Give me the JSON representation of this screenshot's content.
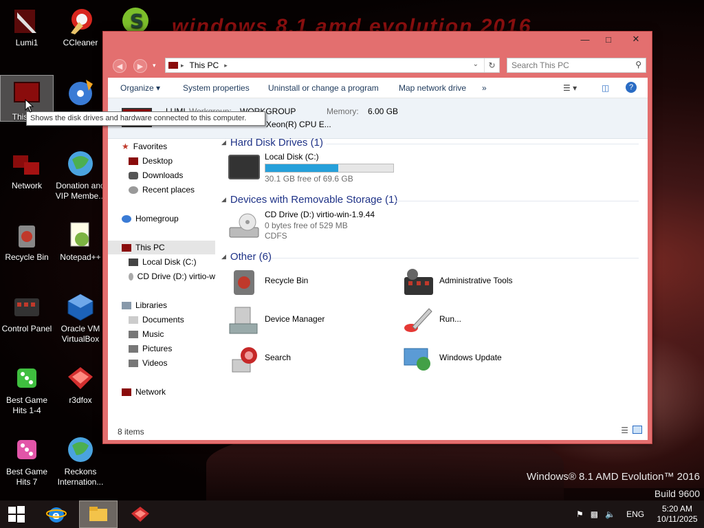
{
  "desktop": {
    "banner": "windows 8.1 amd evolution 2016",
    "brand_line1": "Windows® 8.1 AMD Evolution™ 2016",
    "brand_line2": "Build 9600",
    "icons": [
      {
        "label": "Lumi1"
      },
      {
        "label": "CCleaner"
      },
      {
        "label": "This PC"
      },
      {
        "label": ""
      },
      {
        "label": "Network"
      },
      {
        "label": "Donation and VIP Membe..."
      },
      {
        "label": "Recycle Bin"
      },
      {
        "label": "Notepad++"
      },
      {
        "label": "Control Panel"
      },
      {
        "label": "Oracle VM VirtualBox"
      },
      {
        "label": "Best Game Hits 1-4"
      },
      {
        "label": "r3dfox"
      },
      {
        "label": "Best Game Hits 7"
      },
      {
        "label": "Reckons Internation..."
      }
    ],
    "tooltip": "Shows the disk drives and hardware connected to this computer."
  },
  "window": {
    "address": "This PC",
    "search_placeholder": "Search This PC",
    "toolbar": {
      "organize": "Organize",
      "system_properties": "System properties",
      "uninstall": "Uninstall or change a program",
      "map_drive": "Map network drive",
      "more": "»"
    },
    "details": {
      "name": "LUMI",
      "workgroup_label": "Workgroup:",
      "workgroup": "WORKGROUP",
      "memory_label": "Memory:",
      "memory": "6.00 GB",
      "processor": "Xeon(R) CPU E..."
    },
    "nav": {
      "favorites": "Favorites",
      "desktop": "Desktop",
      "downloads": "Downloads",
      "recent": "Recent places",
      "homegroup": "Homegroup",
      "this_pc": "This PC",
      "local_disk": "Local Disk (C:)",
      "cd_drive": "CD Drive (D:) virtio-w",
      "libraries": "Libraries",
      "documents": "Documents",
      "music": "Music",
      "pictures": "Pictures",
      "videos": "Videos",
      "network": "Network"
    },
    "groups": {
      "hdd": "Hard Disk Drives (1)",
      "removable": "Devices with Removable Storage (1)",
      "other": "Other (6)"
    },
    "local_disk": {
      "name": "Local Disk (C:)",
      "free": "30.1 GB free of 69.6 GB",
      "used_fraction": 0.568
    },
    "cd_drive": {
      "name": "CD Drive (D:) virtio-win-1.9.44",
      "free": "0 bytes free of 529 MB",
      "fs": "CDFS"
    },
    "other_items": {
      "recycle": "Recycle Bin",
      "admin": "Administrative Tools",
      "device": "Device Manager",
      "run": "Run...",
      "search": "Search",
      "update": "Windows Update"
    },
    "status": "8 items"
  },
  "taskbar": {
    "lang": "ENG",
    "time": "5:20 AM",
    "date": "10/11/2025"
  },
  "colors": {
    "window_frame": "#e36f6f",
    "accent_blue": "#26a0da",
    "link_blue": "#1e3287"
  }
}
